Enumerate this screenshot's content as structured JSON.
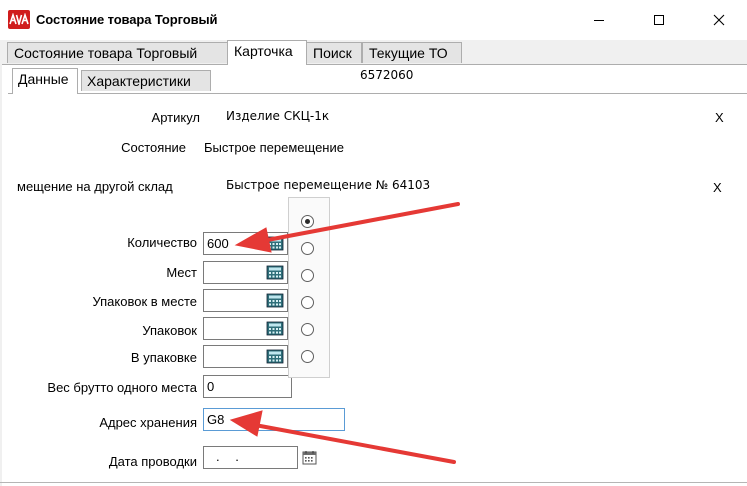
{
  "window": {
    "title": "Состояние товара Торговый",
    "controls": [
      "minimize",
      "maximize",
      "close"
    ]
  },
  "tabs": [
    {
      "label": "Состояние товара Торговый",
      "active": false
    },
    {
      "label": "Карточка",
      "active": true
    },
    {
      "label": "Поиск",
      "active": false
    },
    {
      "label": "Текущие ТО",
      "active": false
    }
  ],
  "subtabs": [
    {
      "label": "Данные",
      "active": true
    },
    {
      "label": "Характеристики",
      "active": false
    }
  ],
  "code": "6572060",
  "info": {
    "article_label": "Артикул",
    "article_value": "Изделие СКЦ-1к",
    "state_label": "Состояние",
    "state_value": "Быстрое перемещение",
    "move_label": "мещение на другой склад",
    "move_value": "Быстрое перемещение № 64103",
    "clear_mark": "X"
  },
  "form": {
    "quantity_label": "Количество",
    "quantity_value": "600",
    "places_label": "Мест",
    "places_value": "",
    "packs_in_place_label": "Упаковок в месте",
    "packs_in_place_value": "",
    "packs_label": "Упаковок",
    "packs_value": "",
    "in_pack_label": "В упаковке",
    "in_pack_value": "",
    "gross_weight_label": "Вес брутто одного места",
    "gross_weight_value": "0",
    "storage_address_label": "Адрес хранения",
    "storage_address_value": "G8",
    "posting_date_label": "Дата проводки",
    "posting_date_value": ". ."
  },
  "radio_selected_index": 0,
  "icons": {
    "app": "app-logo-icon",
    "calculator": "calculator-icon",
    "calendar": "calendar-icon"
  },
  "colors": {
    "annotation_arrow": "#e53935",
    "app_icon": "#d01c1c"
  }
}
